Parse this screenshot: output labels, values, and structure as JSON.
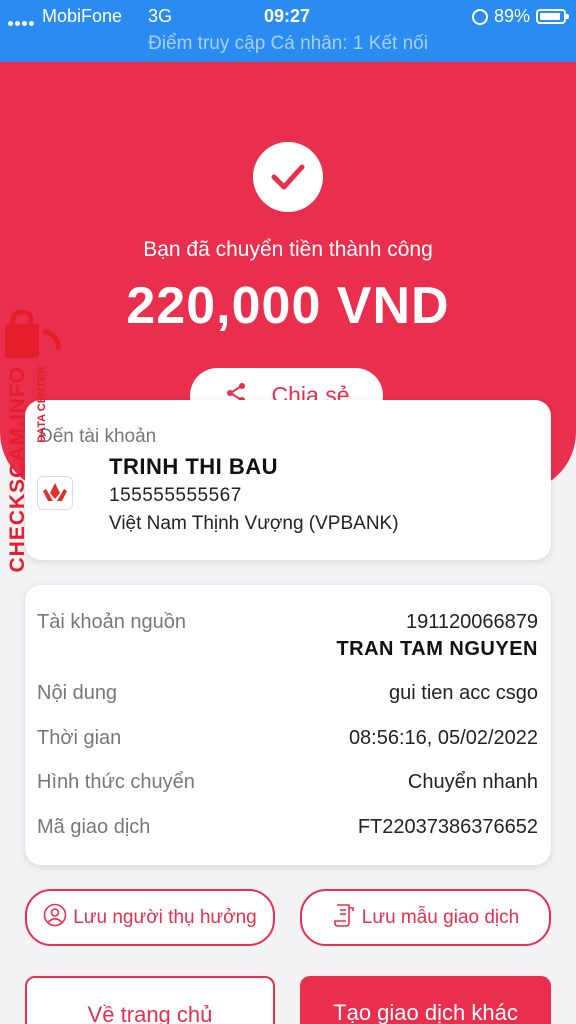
{
  "status_bar": {
    "carrier": "MobiFone",
    "network": "3G",
    "time": "09:27",
    "battery": "89%",
    "battery_level": 0.89,
    "hotspot": "Điểm truy cập Cá nhân: 1 Kết nối"
  },
  "hero": {
    "message": "Bạn đã chuyển tiền thành công",
    "amount": "220,000 VND",
    "share_label": "Chia sẻ"
  },
  "recipient": {
    "label": "Đến tài khoản",
    "name": "TRINH THI BAU",
    "account": "155555555567",
    "bank": "Việt Nam Thịnh Vượng (VPBANK)"
  },
  "details": {
    "source_label": "Tài khoản nguồn",
    "source_account": "191120066879",
    "source_name": "TRAN TAM NGUYEN",
    "content_label": "Nội dung",
    "content_value": "gui tien acc csgo",
    "time_label": "Thời gian",
    "time_value": "08:56:16, 05/02/2022",
    "method_label": "Hình thức chuyển",
    "method_value": "Chuyển nhanh",
    "code_label": "Mã giao dịch",
    "code_value": "FT22037386376652"
  },
  "actions": {
    "save_beneficiary": "Lưu người thụ hưởng",
    "save_template": "Lưu mẫu giao dịch",
    "home": "Về trang chủ",
    "new_transaction": "Tạo giao dịch khác"
  },
  "watermark": {
    "text": "CHECKSCAM.INFO",
    "sub": "DATA CENTER"
  },
  "colors": {
    "primary": "#ea2e4d",
    "status_bar": "#2a8cf0"
  },
  "icons": [
    "check-icon",
    "share-icon",
    "bank-logo-icon",
    "user-icon",
    "document-icon",
    "lock-icon",
    "battery-icon"
  ]
}
